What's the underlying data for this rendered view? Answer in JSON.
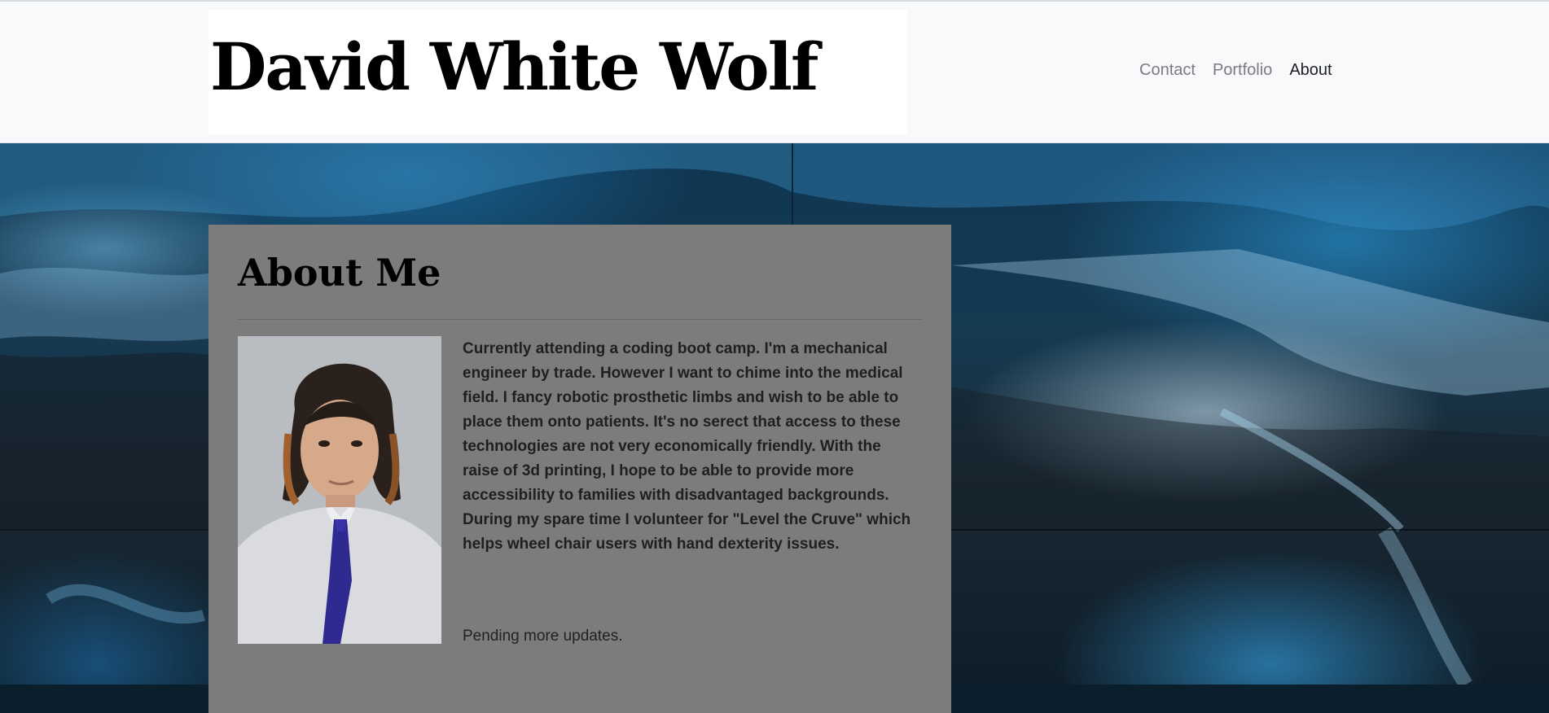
{
  "header": {
    "brand": "David White Wolf",
    "nav": [
      {
        "label": "Contact"
      },
      {
        "label": "Portfolio"
      },
      {
        "label": "About",
        "active": true
      }
    ]
  },
  "hero": {
    "background_icon": "ice-cave-photo"
  },
  "about": {
    "title": "About Me",
    "photo_icon": "profile-portrait",
    "bio": "Currently attending a coding boot camp. I'm a mechanical engineer by trade. However I want to chime into the medical field. I fancy robotic prosthetic limbs and wish to be able to place them onto patients. It's no serect that access to these technologies are not very economically friendly. With the raise of 3d printing, I hope to be able to provide more accessibility to families with disadvantaged backgrounds. During my spare time I volunteer for \"Level the Cruve\" which helps wheel chair users with hand dexterity issues.",
    "pending": "Pending more updates."
  },
  "colors": {
    "navbar_bg": "#f8f9fa",
    "card_bg": "#7c7c7c",
    "nav_link": "#7a7c7f",
    "nav_active": "#1d1f22"
  }
}
